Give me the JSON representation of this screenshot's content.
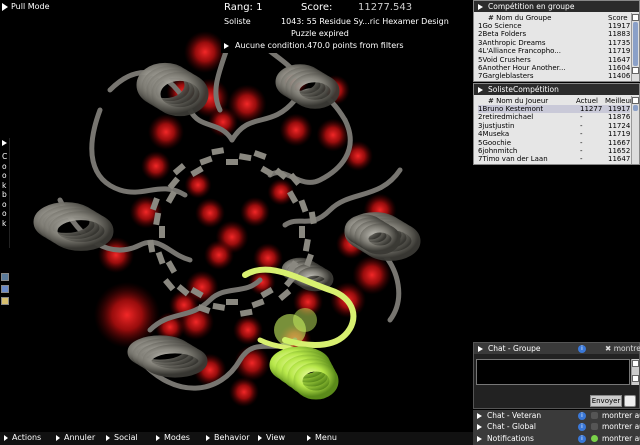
{
  "pull_mode": "Pull Mode",
  "score_panel": {
    "rank": "Rang: 1",
    "score_label": "Score:",
    "score_value": "11277.543",
    "soliste": "Soliste",
    "puzzle": "1043: 55 Residue Sy...ric Hexamer Design",
    "status": "Puzzle expired",
    "condition": "Aucune condition.470.0 points from filters"
  },
  "cookbook": {
    "letters": [
      "C",
      "o",
      "o",
      "k",
      "b",
      "o",
      "o",
      "k"
    ]
  },
  "toolbar": {
    "items": [
      "Actions",
      "Annuler",
      "Social",
      "Modes",
      "Behavior",
      "View",
      "Menu"
    ]
  },
  "group_panel": {
    "title": "Compétition en groupe",
    "col_name": "# Nom du Groupe",
    "col_score": "Score",
    "rows": [
      {
        "rank": "1",
        "name": "Go Science",
        "score": "11917"
      },
      {
        "rank": "2",
        "name": "Beta Folders",
        "score": "11883"
      },
      {
        "rank": "3",
        "name": "Anthropic Dreams",
        "score": "11735"
      },
      {
        "rank": "4",
        "name": "L'Alliance Francopho...",
        "score": "11719"
      },
      {
        "rank": "5",
        "name": "Void Crushers",
        "score": "11647"
      },
      {
        "rank": "6",
        "name": "Another Hour Another...",
        "score": "11604"
      },
      {
        "rank": "7",
        "name": "Gargleblasters",
        "score": "11406"
      }
    ]
  },
  "solo_panel": {
    "title": "SolisteCompétition",
    "col_name": "# Nom du Joueur",
    "col_current": "Actuel",
    "col_best": "Meilleur",
    "rows": [
      {
        "rank": "1",
        "name": "Bruno Kestemont",
        "current": "11277",
        "best": "11917"
      },
      {
        "rank": "2",
        "name": "retiredmichael",
        "current": "-",
        "best": "11876"
      },
      {
        "rank": "3",
        "name": "justjustin",
        "current": "-",
        "best": "11724"
      },
      {
        "rank": "4",
        "name": "Museka",
        "current": "-",
        "best": "11719"
      },
      {
        "rank": "5",
        "name": "Goochie",
        "current": "-",
        "best": "11667"
      },
      {
        "rank": "6",
        "name": "johnmitch",
        "current": "-",
        "best": "11652"
      },
      {
        "rank": "7",
        "name": "Timo van der Laan",
        "current": "-",
        "best": "11647"
      }
    ]
  },
  "chat": {
    "group_title": "Chat - Groupe",
    "show_all": "montrer aut",
    "send": "Envoyer",
    "veteran": "Chat - Veteran",
    "global": "Chat - Global",
    "notifications": "Notifications",
    "info_glyph": "i"
  },
  "colors": {
    "protein_grey": "#8a8880",
    "highlight_green": "#c8f060",
    "void_red": "#cc1111"
  }
}
